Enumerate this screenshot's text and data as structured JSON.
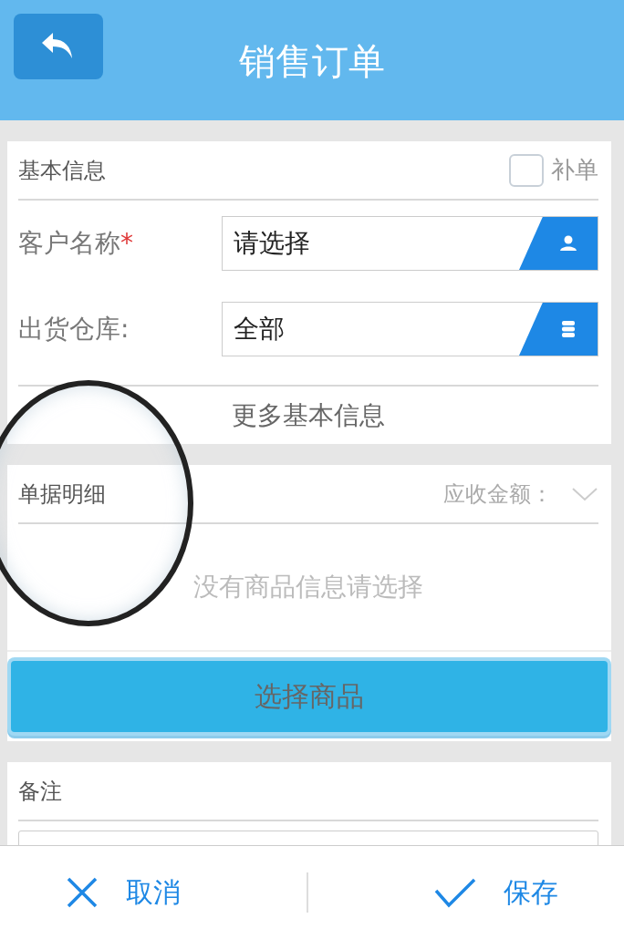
{
  "header": {
    "title": "销售订单"
  },
  "basic_info": {
    "title": "基本信息",
    "supplement": {
      "label": "补单",
      "checked": false
    },
    "fields": [
      {
        "label": "客户名称",
        "required_mark": "*",
        "value": "请选择",
        "kind": "customer"
      },
      {
        "label": "出货仓库:",
        "value": "全部",
        "kind": "warehouse"
      }
    ],
    "more_link": "更多基本信息"
  },
  "details": {
    "title": "单据明细",
    "amount_label": "应收金额：",
    "expanded": false,
    "empty_text": "没有商品信息请选择",
    "select_button": "选择商品"
  },
  "remarks": {
    "title": "备注"
  },
  "footer": {
    "buttons": [
      {
        "label": "取消",
        "kind": "cancel"
      },
      {
        "label": "保存",
        "kind": "save"
      }
    ]
  }
}
